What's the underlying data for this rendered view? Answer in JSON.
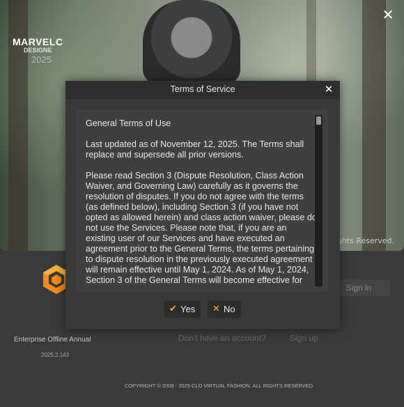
{
  "splash": {
    "close_glyph": "✕",
    "rights_partial": "Rights Reserved."
  },
  "brand": {
    "name": "MARVELC",
    "sub": "DESIGNE",
    "year": "2025",
    "edition": "Enterprise Offline Annual",
    "version": "2025.2.143"
  },
  "login": {
    "signin_label": "Sign in",
    "no_account": "Don't have an account?",
    "signup_label": "Sign up"
  },
  "footer": {
    "copyright": "COPYRIGHT © 2009 - 2025 CLO VIRTUAL FASHION. ALL RIGHTS RESERVED."
  },
  "dialog": {
    "title": "Terms of Service",
    "close_glyph": "✕",
    "paragraphs": [
      "General Terms of Use",
      "Last updated as of November 12, 2025. The Terms shall replace and supersede all prior versions.",
      "Please read Section 3 (Dispute Resolution, Class Action Waiver, and Governing Law) carefully as it governs the resolution of disputes. If you do not agree with the terms (as defined below), including Section 3 (if you have not opted as allowed herein) and class action waiver, please do not use the Services. Please note that, if you are an existing user of our Services and have executed an agreement prior to the General Terms, the terms pertaining to dispute resolution in the previously executed agreement will remain effective until May 1, 2024. As of May 1, 2024, Section 3 of the General Terms will become effective for"
    ],
    "yes_label": "Yes",
    "no_label": "No",
    "yes_icon": "check-icon",
    "no_icon": "x-icon"
  },
  "colors": {
    "accent": "#f0b326",
    "dialog_bg": "#383838",
    "titlebar_bg": "#2d2d2d",
    "panel_bg": "#3a3a3a"
  }
}
